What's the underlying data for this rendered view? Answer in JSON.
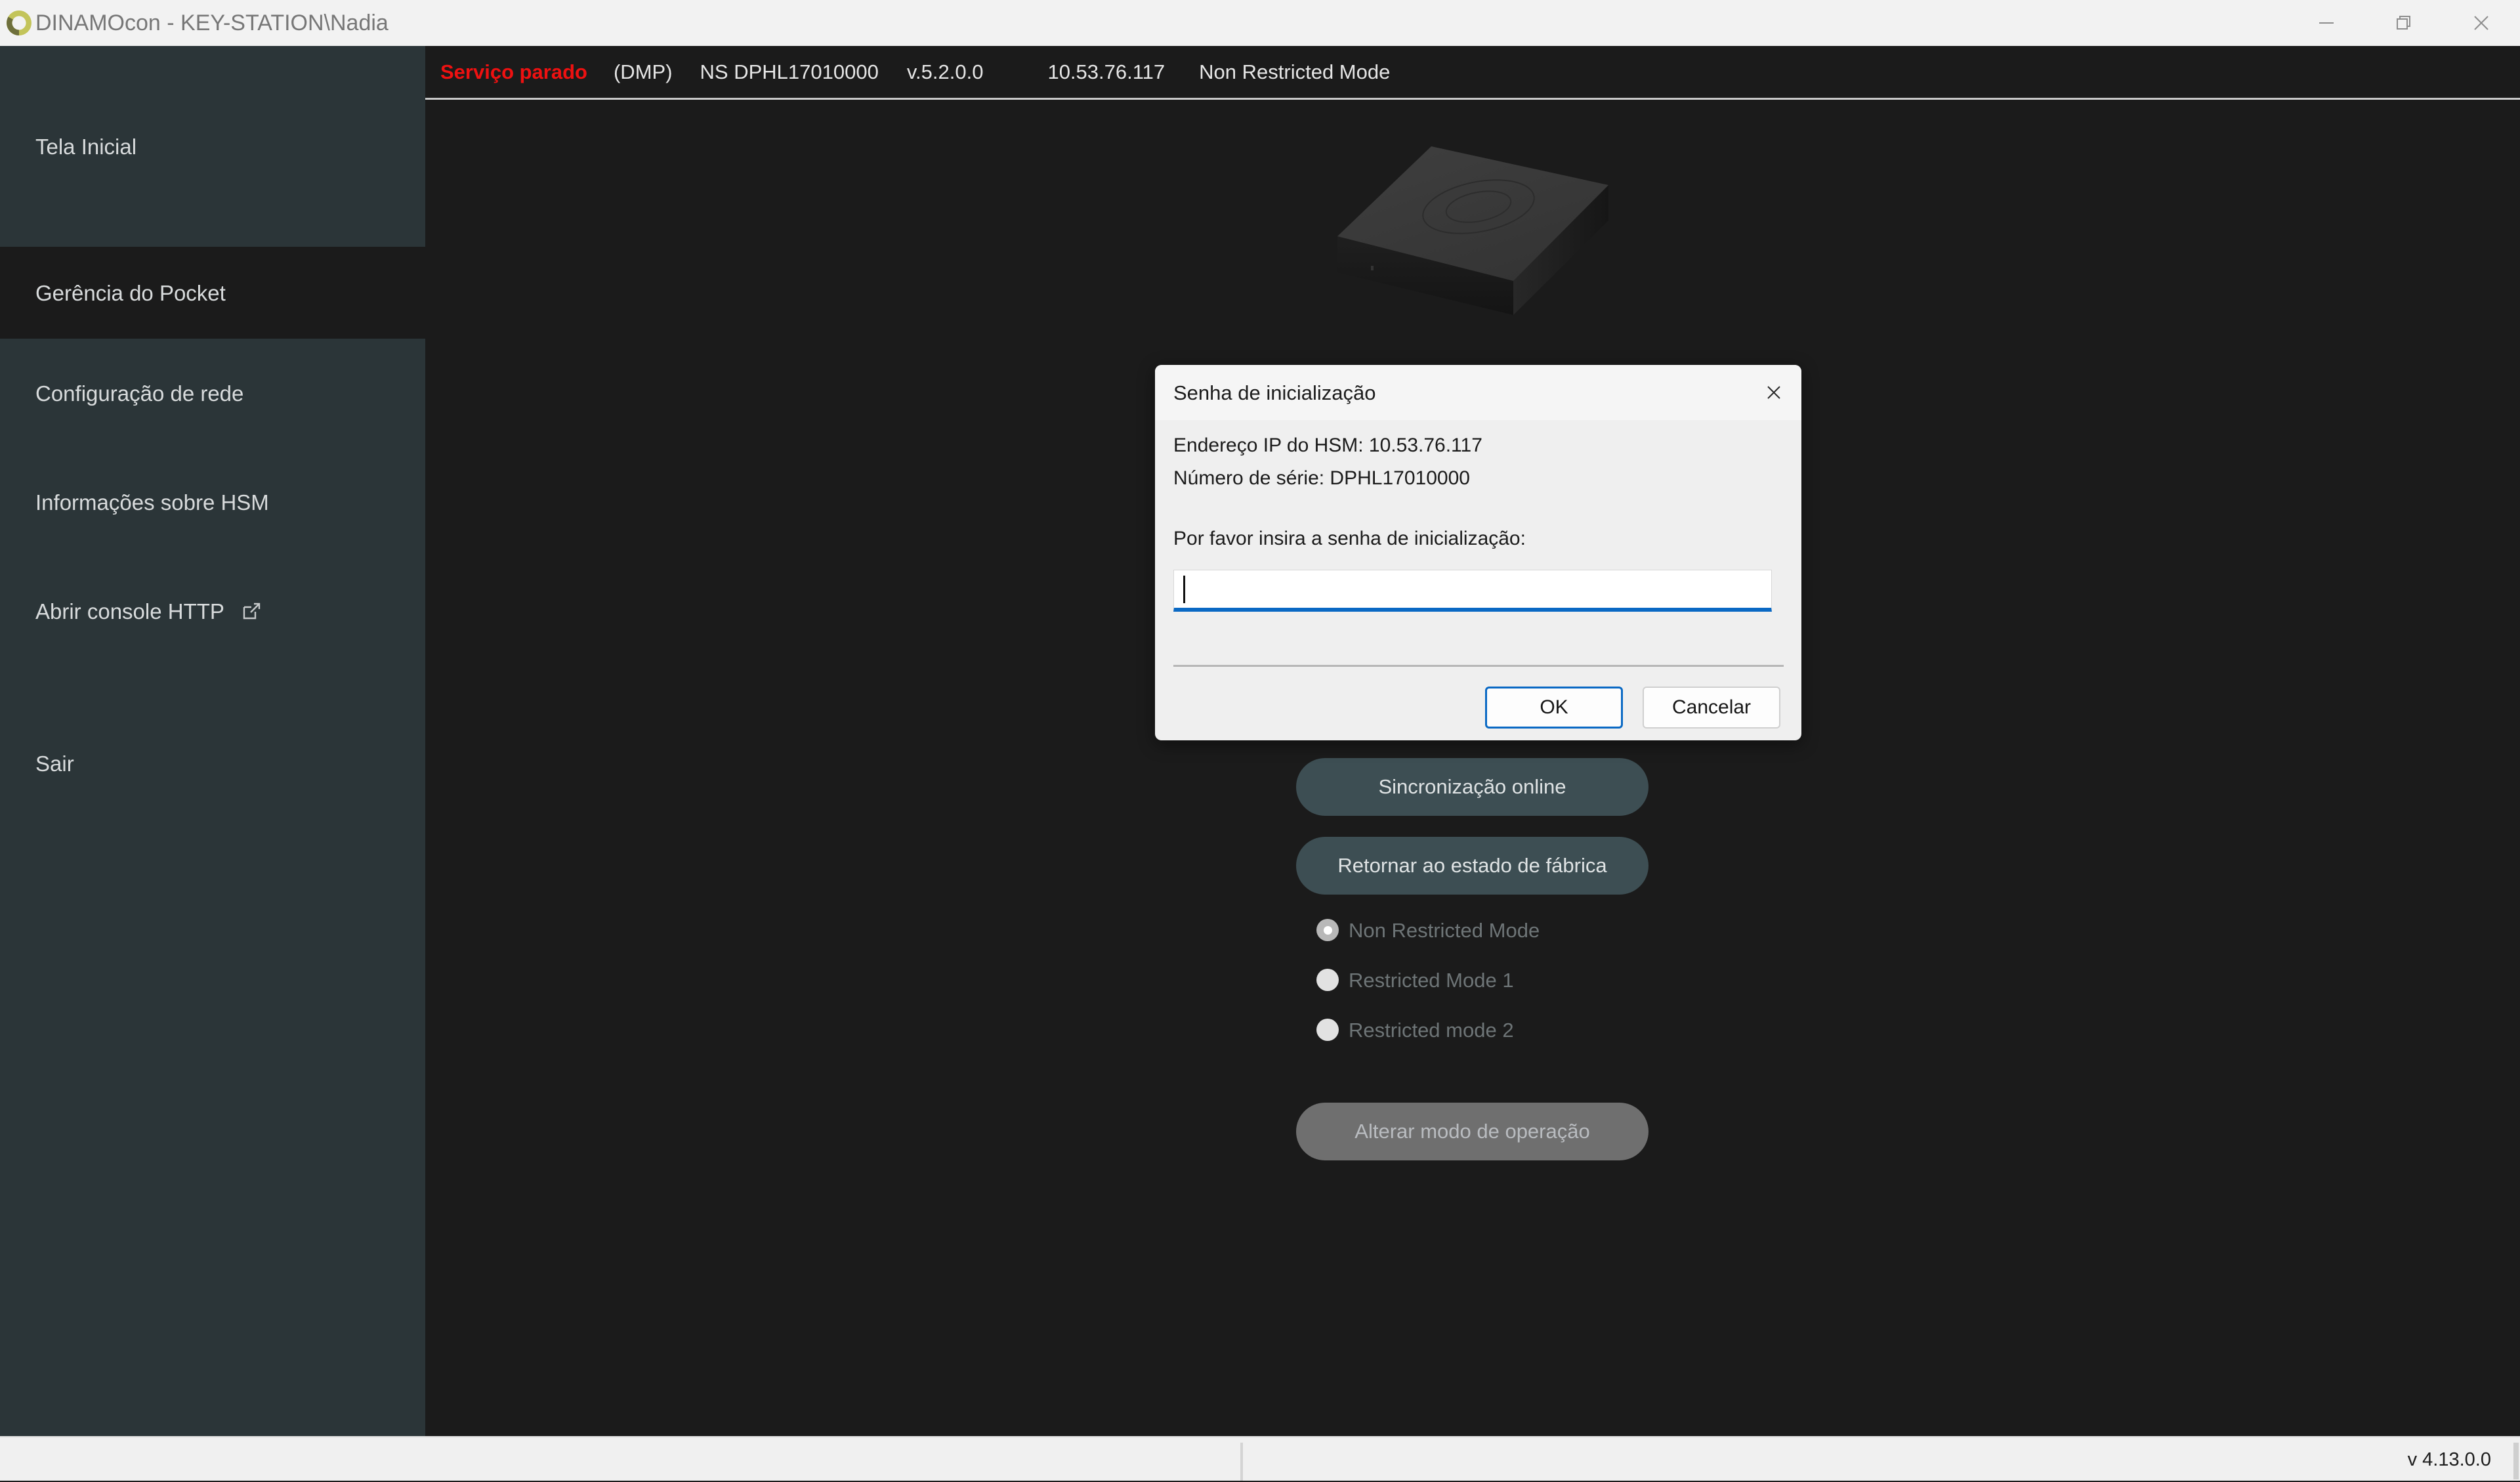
{
  "window": {
    "title": "DINAMOcon - KEY-STATION\\Nadia",
    "logo_outer_color": "#c3c45a",
    "logo_inner_color": "#6e6f3c",
    "controls": {
      "minimize": "minimize-icon",
      "restore": "restore-icon",
      "close": "close-icon"
    }
  },
  "sidebar": {
    "items": [
      {
        "label": "Tela Inicial",
        "selected": false,
        "icon": ""
      },
      {
        "label": "Gerência do Pocket",
        "selected": true,
        "icon": ""
      },
      {
        "label": "Configuração de rede",
        "selected": false,
        "icon": ""
      },
      {
        "label": "Informações sobre HSM",
        "selected": false,
        "icon": ""
      },
      {
        "label": "Abrir console HTTP",
        "selected": false,
        "icon": "external-link-icon"
      },
      {
        "label": "Sair",
        "selected": false,
        "icon": ""
      }
    ]
  },
  "statusbar": {
    "service": "Serviço parado",
    "service_color": "#ee1111",
    "protocol": "(DMP)",
    "serial": "NS DPHL17010000",
    "version": "v.5.2.0.0",
    "ip": "10.53.76.117",
    "mode": "Non Restricted Mode"
  },
  "main": {
    "device_image": "hsm-pocket-device",
    "buttons": {
      "sync": "Sincronização online",
      "factory_reset": "Retornar ao estado de fábrica",
      "change_mode": "Alterar modo de operação",
      "change_mode_disabled": true
    },
    "operation_modes": [
      {
        "label": "Non Restricted Mode",
        "checked": true
      },
      {
        "label": "Restricted Mode 1",
        "checked": false
      },
      {
        "label": "Restricted mode 2",
        "checked": false
      }
    ]
  },
  "dialog": {
    "title": "Senha de inicialização",
    "ip_line": "Endereço IP do HSM: 10.53.76.117",
    "serial_line": "Número de série: DPHL17010000",
    "prompt": "Por favor insira a senha de inicialização:",
    "password_value": "",
    "ok_label": "OK",
    "cancel_label": "Cancelar",
    "accent_color": "#0a69c4"
  },
  "footer": {
    "version": "v 4.13.0.0"
  }
}
